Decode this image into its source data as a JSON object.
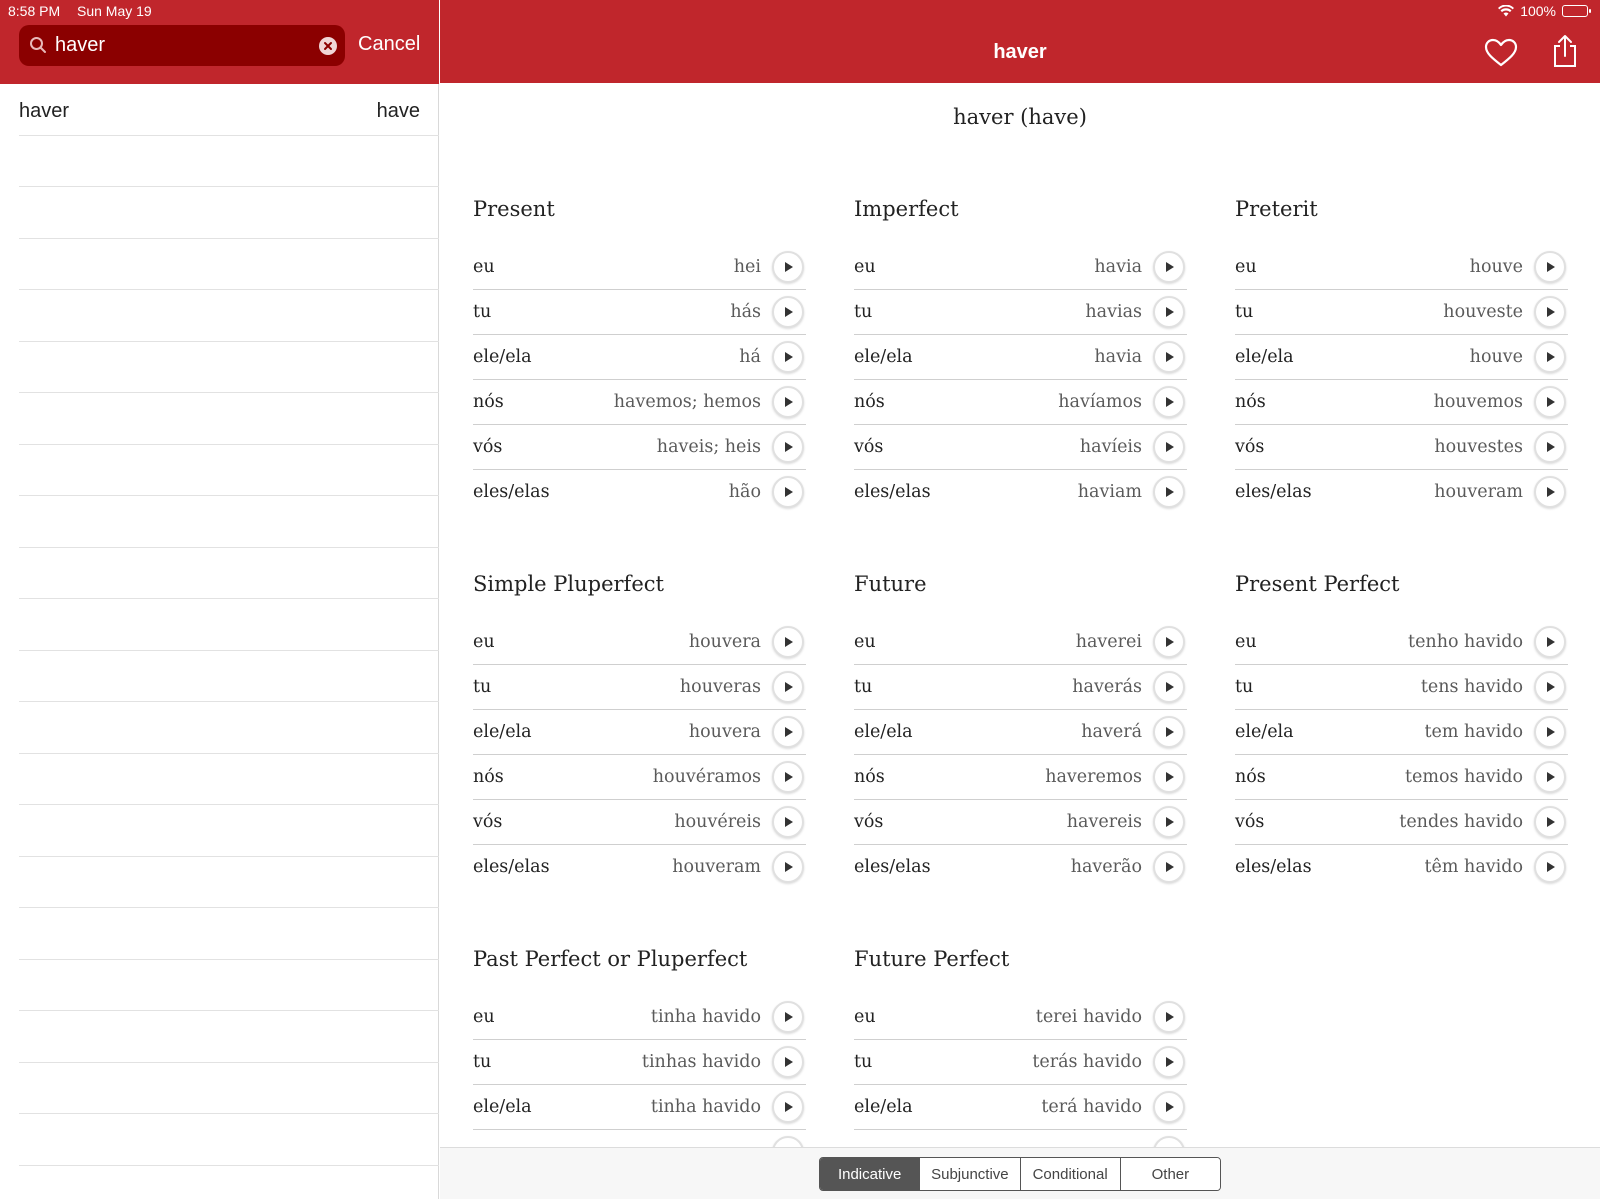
{
  "status": {
    "time": "8:58 PM",
    "date": "Sun May 19",
    "battery": "100%"
  },
  "search": {
    "value": "haver",
    "cancel": "Cancel"
  },
  "results": [
    {
      "word": "haver",
      "meaning": "have"
    }
  ],
  "nav": {
    "title": "haver"
  },
  "verb_title": "haver (have)",
  "tenses": [
    {
      "name": "Present",
      "rows": [
        {
          "p": "eu",
          "f": "hei"
        },
        {
          "p": "tu",
          "f": "hás"
        },
        {
          "p": "ele/ela",
          "f": "há"
        },
        {
          "p": "nós",
          "f": "havemos; hemos"
        },
        {
          "p": "vós",
          "f": "haveis; heis"
        },
        {
          "p": "eles/elas",
          "f": "hão"
        }
      ]
    },
    {
      "name": "Imperfect",
      "rows": [
        {
          "p": "eu",
          "f": "havia"
        },
        {
          "p": "tu",
          "f": "havias"
        },
        {
          "p": "ele/ela",
          "f": "havia"
        },
        {
          "p": "nós",
          "f": "havíamos"
        },
        {
          "p": "vós",
          "f": "havíeis"
        },
        {
          "p": "eles/elas",
          "f": "haviam"
        }
      ]
    },
    {
      "name": "Preterit",
      "rows": [
        {
          "p": "eu",
          "f": "houve"
        },
        {
          "p": "tu",
          "f": "houveste"
        },
        {
          "p": "ele/ela",
          "f": "houve"
        },
        {
          "p": "nós",
          "f": "houvemos"
        },
        {
          "p": "vós",
          "f": "houvestes"
        },
        {
          "p": "eles/elas",
          "f": "houveram"
        }
      ]
    },
    {
      "name": "Simple Pluperfect",
      "rows": [
        {
          "p": "eu",
          "f": "houvera"
        },
        {
          "p": "tu",
          "f": "houveras"
        },
        {
          "p": "ele/ela",
          "f": "houvera"
        },
        {
          "p": "nós",
          "f": "houvéramos"
        },
        {
          "p": "vós",
          "f": "houvéreis"
        },
        {
          "p": "eles/elas",
          "f": "houveram"
        }
      ]
    },
    {
      "name": "Future",
      "rows": [
        {
          "p": "eu",
          "f": "haverei"
        },
        {
          "p": "tu",
          "f": "haverás"
        },
        {
          "p": "ele/ela",
          "f": "haverá"
        },
        {
          "p": "nós",
          "f": "haveremos"
        },
        {
          "p": "vós",
          "f": "havereis"
        },
        {
          "p": "eles/elas",
          "f": "haverão"
        }
      ]
    },
    {
      "name": "Present Perfect",
      "rows": [
        {
          "p": "eu",
          "f": "tenho havido"
        },
        {
          "p": "tu",
          "f": "tens havido"
        },
        {
          "p": "ele/ela",
          "f": "tem havido"
        },
        {
          "p": "nós",
          "f": "temos havido"
        },
        {
          "p": "vós",
          "f": "tendes havido"
        },
        {
          "p": "eles/elas",
          "f": "têm havido"
        }
      ]
    },
    {
      "name": "Past Perfect or Pluperfect",
      "rows": [
        {
          "p": "eu",
          "f": "tinha havido"
        },
        {
          "p": "tu",
          "f": "tinhas havido"
        },
        {
          "p": "ele/ela",
          "f": "tinha havido"
        }
      ]
    },
    {
      "name": "Future Perfect",
      "rows": [
        {
          "p": "eu",
          "f": "terei havido"
        },
        {
          "p": "tu",
          "f": "terás havido"
        },
        {
          "p": "ele/ela",
          "f": "terá havido"
        }
      ]
    }
  ],
  "mood_tabs": [
    {
      "label": "Indicative",
      "selected": true
    },
    {
      "label": "Subjunctive",
      "selected": false
    },
    {
      "label": "Conditional",
      "selected": false
    },
    {
      "label": "Other",
      "selected": false
    }
  ],
  "colors": {
    "brand_red": "#c0262c",
    "search_bg": "#8b0000"
  }
}
